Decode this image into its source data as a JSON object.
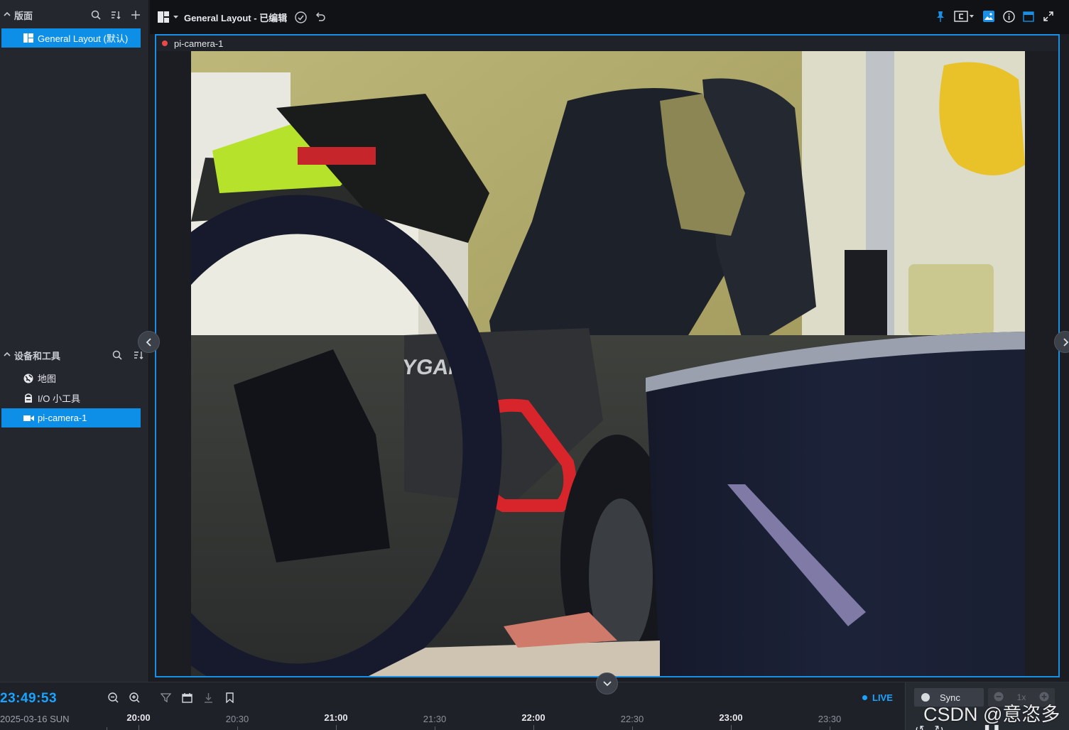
{
  "sidebar": {
    "layouts_section": {
      "title": "版面"
    },
    "layouts": [
      {
        "label": "General Layout (默认)",
        "active": true
      }
    ],
    "devices_section": {
      "title": "设备和工具"
    },
    "devices": [
      {
        "label": "地图",
        "icon": "globe-icon",
        "active": false
      },
      {
        "label": "I/O 小工具",
        "icon": "io-tool-icon",
        "active": false
      },
      {
        "label": "pi-camera-1",
        "icon": "camera-icon",
        "active": true
      }
    ]
  },
  "topbar": {
    "layout_title": "General Layout - 已编辑"
  },
  "camera": {
    "name": "pi-camera-1",
    "recording_color": "#e84a4a"
  },
  "timeline": {
    "clock": "23:49:53",
    "date": "2025-03-16 SUN",
    "live_label": "LIVE",
    "ticks": [
      {
        "label": "20:00",
        "major": true
      },
      {
        "label": "20:30",
        "major": false
      },
      {
        "label": "21:00",
        "major": true
      },
      {
        "label": "21:30",
        "major": false
      },
      {
        "label": "22:00",
        "major": true
      },
      {
        "label": "22:30",
        "major": false
      },
      {
        "label": "23:00",
        "major": true
      },
      {
        "label": "23:30",
        "major": false
      }
    ],
    "sync_label": "Sync",
    "speed_label": "1x"
  },
  "watermark": "CSDN @意恣多",
  "colors": {
    "accent": "#0d8fe8",
    "live": "#1aa3ff",
    "panel_border": "#1a8fe6"
  }
}
